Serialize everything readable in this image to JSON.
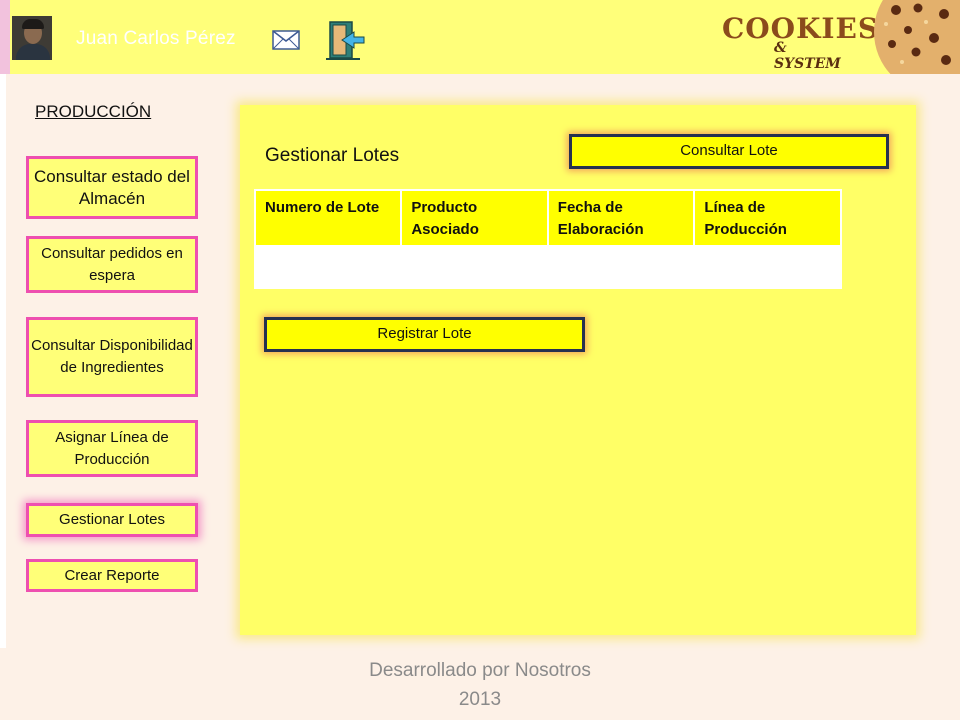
{
  "header": {
    "user_name": "Juan Carlos Pérez",
    "logo_title": "COOKIES",
    "logo_subtitle": "& SYSTEM",
    "icons": [
      "avatar",
      "mail-icon",
      "exit-door-icon",
      "cookie-art"
    ]
  },
  "sidebar": {
    "section_title": "PRODUCCIÓN",
    "items": [
      {
        "label": "Consultar estado del Almacén"
      },
      {
        "label": "Consultar pedidos en espera"
      },
      {
        "label": "Consultar Disponibilidad de Ingredientes"
      },
      {
        "label": "Asignar Línea de Producción"
      },
      {
        "label": "Gestionar Lotes",
        "active": true
      },
      {
        "label": "Crear Reporte"
      }
    ]
  },
  "main": {
    "title": "Gestionar Lotes",
    "consultar_label": "Consultar Lote",
    "registrar_label": "Registrar Lote",
    "table": {
      "columns": [
        "Numero de Lote",
        "Producto Asociado",
        "Fecha de Elaboración",
        "Línea de Producción"
      ],
      "rows": []
    }
  },
  "footer": {
    "line1": "Desarrollado por Nosotros",
    "line2": "2013"
  },
  "colors": {
    "header_bg": "#ffff7a",
    "panel_bg": "#ffff66",
    "nav_border": "#ee4fb0",
    "button_border": "#26314f",
    "page_bg": "#fdf1e7"
  }
}
